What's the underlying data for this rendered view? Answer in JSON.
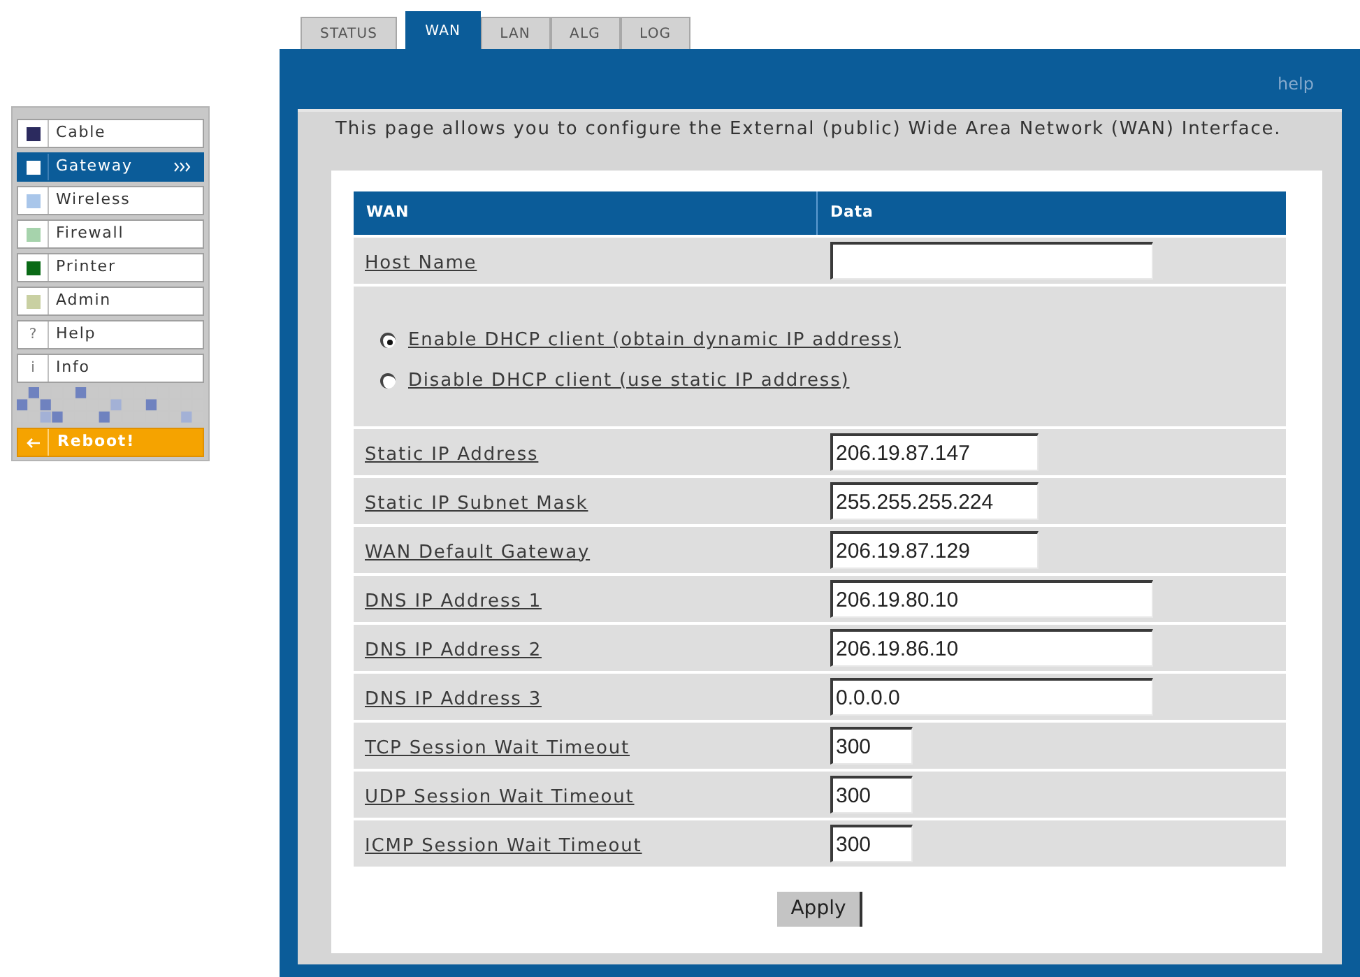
{
  "sidebar": {
    "items": [
      {
        "kind": "swatch",
        "label": "Cable",
        "color": "#2b2a5e",
        "selected": false
      },
      {
        "kind": "swatch",
        "label": "Gateway",
        "color": "#ffffff",
        "selected": true
      },
      {
        "kind": "swatch",
        "label": "Wireless",
        "color": "#a9c6ea",
        "selected": false
      },
      {
        "kind": "swatch",
        "label": "Firewall",
        "color": "#a6d3ac",
        "selected": false
      },
      {
        "kind": "swatch",
        "label": "Printer",
        "color": "#0a6a16",
        "selected": false
      },
      {
        "kind": "swatch",
        "label": "Admin",
        "color": "#c9d0a2",
        "selected": false
      },
      {
        "kind": "glyph",
        "glyph": "?",
        "label": "Help",
        "selected": false
      },
      {
        "kind": "glyph",
        "glyph": "i",
        "label": "Info",
        "selected": false
      }
    ],
    "reboot_button": {
      "label": "Reboot!"
    }
  },
  "tabs": [
    {
      "label": "STATUS",
      "selected": false
    },
    {
      "label": "WAN",
      "selected": true
    },
    {
      "label": "LAN",
      "selected": false
    },
    {
      "label": "ALG",
      "selected": false
    },
    {
      "label": "LOG",
      "selected": false
    }
  ],
  "help_link": "help",
  "description": "This page allows you to configure the External (public) Wide Area Network (WAN) Interface.",
  "table": {
    "columns": [
      "WAN",
      "Data"
    ],
    "rows": [
      {
        "kind": "wide",
        "label": "Host Name"
      },
      {
        "kind": "radio",
        "options": [
          {
            "label": "Enable DHCP client (obtain dynamic IP address)",
            "selected": true
          },
          {
            "label": "Disable DHCP client (use static IP address)",
            "selected": false
          }
        ]
      },
      {
        "kind": "medium",
        "label": "Static IP Address",
        "value": "206.19.87.147"
      },
      {
        "kind": "medium",
        "label": "Static IP Subnet Mask",
        "value": "255.255.255.224"
      },
      {
        "kind": "medium",
        "label": "WAN Default Gateway",
        "value": "206.19.87.129"
      },
      {
        "kind": "wide",
        "label": "DNS IP Address 1",
        "value": "206.19.80.10"
      },
      {
        "kind": "wide",
        "label": "DNS IP Address 2",
        "value": "206.19.86.10"
      },
      {
        "kind": "wide",
        "label": "DNS IP Address 3",
        "value": "0.0.0.0"
      },
      {
        "kind": "narrow",
        "label": "TCP Session Wait Timeout",
        "value": "300"
      },
      {
        "kind": "narrow",
        "label": "UDP Session Wait Timeout",
        "value": "300"
      },
      {
        "kind": "narrow",
        "label": "ICMP Session Wait Timeout",
        "value": "300"
      }
    ]
  },
  "apply_button": "Apply"
}
